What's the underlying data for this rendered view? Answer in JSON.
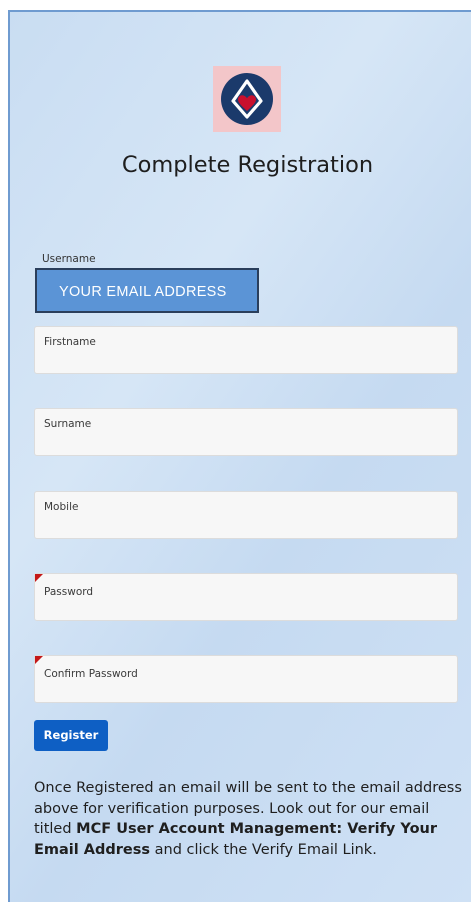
{
  "page": {
    "title": "Complete Registration"
  },
  "logo": {
    "icon": "masonic-emblem-icon",
    "bg_color": "#f3c6c9",
    "circle_color": "#1b3a6b",
    "heart_color": "#c8102e"
  },
  "username": {
    "label": "Username",
    "value": "YOUR EMAIL ADDRESS"
  },
  "fields": [
    {
      "label": "Firstname",
      "required": false
    },
    {
      "label": "Surname",
      "required": false
    },
    {
      "label": "Mobile",
      "required": false
    },
    {
      "label": "Password",
      "required": true
    },
    {
      "label": "Confirm Password",
      "required": true
    }
  ],
  "register_button": {
    "label": "Register"
  },
  "note": {
    "part1": "Once Registered an email will be sent to the email address above for verification purposes. Look out for our email titled ",
    "bold": "MCF User Account Management: Verify Your Email Address",
    "part2": " and click the Verify Email Link."
  },
  "colors": {
    "accent": "#0e5fc4",
    "username_bg": "#5b94d6",
    "required_marker": "#c41818"
  }
}
